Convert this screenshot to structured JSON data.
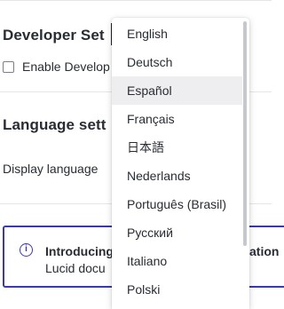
{
  "developer_settings": {
    "heading": "Developer Set",
    "enable_label": "Enable Develop"
  },
  "language_settings": {
    "heading": "Language sett",
    "display_language_label": "Display language"
  },
  "info_banner": {
    "icon": "info-icon",
    "title": "Introducing",
    "title_tail": "ation",
    "body": "Lucid docu"
  },
  "dropdown": {
    "highlighted": "Español",
    "options": [
      "English",
      "Deutsch",
      "Español",
      "Français",
      "日本語",
      "Nederlands",
      "Português (Brasil)",
      "Русский",
      "Italiano",
      "Polski"
    ]
  },
  "colors": {
    "accent": "#3a3aa8",
    "text": "#282c33",
    "highlight": "#eeeef0",
    "divider": "#e4e6ea"
  }
}
